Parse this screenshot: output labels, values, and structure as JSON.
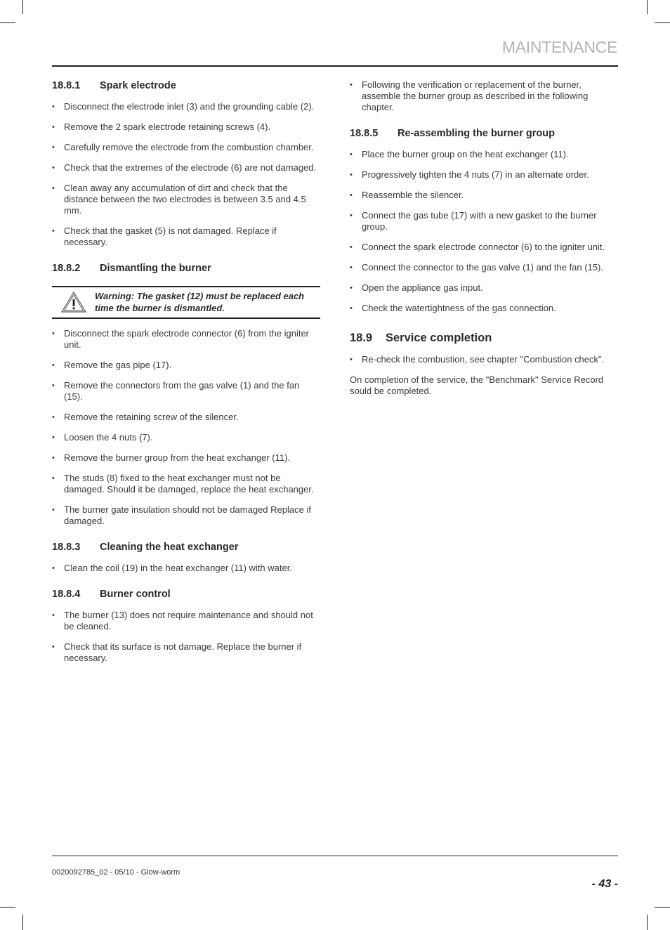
{
  "header": {
    "title": "MAINTENANCE"
  },
  "left_column": {
    "s1881": {
      "number": "18.8.1",
      "title": "Spark electrode",
      "items": [
        "Disconnect the electrode inlet (3) and the grounding cable (2).",
        "Remove the 2 spark electrode retaining screws (4).",
        "Carefully remove the electrode from the combustion chamber.",
        "Check that the extremes of the electrode (6) are not damaged.",
        "Clean away any accumulation of dirt and check that the distance between the two electrodes is between 3.5 and 4.5 mm.",
        "Check that the gasket (5) is not damaged. Replace if necessary."
      ]
    },
    "s1882": {
      "number": "18.8.2",
      "title": "Dismantling the burner",
      "warning": {
        "icon": "warning-triangle-icon",
        "text": "Warning: The gasket (12) must be replaced each time the burner is dismantled."
      },
      "items": [
        "Disconnect the spark electrode connector (6) from the igniter unit.",
        "Remove the gas pipe (17).",
        "Remove the connectors from the gas valve (1) and the fan (15).",
        "Remove the retaining screw of the silencer.",
        "Loosen the 4 nuts (7).",
        "Remove the burner group from the heat exchanger (11).",
        "The studs (8) fixed to the heat exchanger must not be damaged. Should it be damaged, replace the heat exchanger.",
        "The burner gate insulation should not be damaged Replace if damaged."
      ]
    },
    "s1883": {
      "number": "18.8.3",
      "title": "Cleaning the heat exchanger",
      "items": [
        "Clean the coil (19) in the heat exchanger (11) with water."
      ]
    },
    "s1884": {
      "number": "18.8.4",
      "title": "Burner control",
      "items": [
        "The burner (13) does not require maintenance and should not be cleaned.",
        "Check that its surface is not damage. Replace the burner if necessary."
      ]
    }
  },
  "right_column": {
    "continued_items": [
      "Following the verification or replacement of the burner, assemble the burner group as described in the following chapter."
    ],
    "s1885": {
      "number": "18.8.5",
      "title": "Re-assembling the burner group",
      "items": [
        "Place the burner group on the heat exchanger (11).",
        "Progressively tighten the 4 nuts (7) in an alternate order.",
        "Reassemble the silencer.",
        "Connect the gas tube (17) with a new gasket to the burner group.",
        "Connect the spark electrode connector (6) to the igniter unit.",
        "Connect the connector to the gas valve (1) and the fan (15).",
        "Open the appliance gas input.",
        "Check the watertightness of the gas connection."
      ]
    },
    "s189": {
      "number": "18.9",
      "title": "Service completion",
      "items": [
        "Re-check the combustion, see chapter \"Combustion check\"."
      ],
      "paragraph": "On completion of the service, the \"Benchmark\" Service Record sould be completed."
    }
  },
  "footer": {
    "doc_ref": "0020092785_02 - 05/10 - Glow-worm",
    "page_number": "- 43 -"
  }
}
